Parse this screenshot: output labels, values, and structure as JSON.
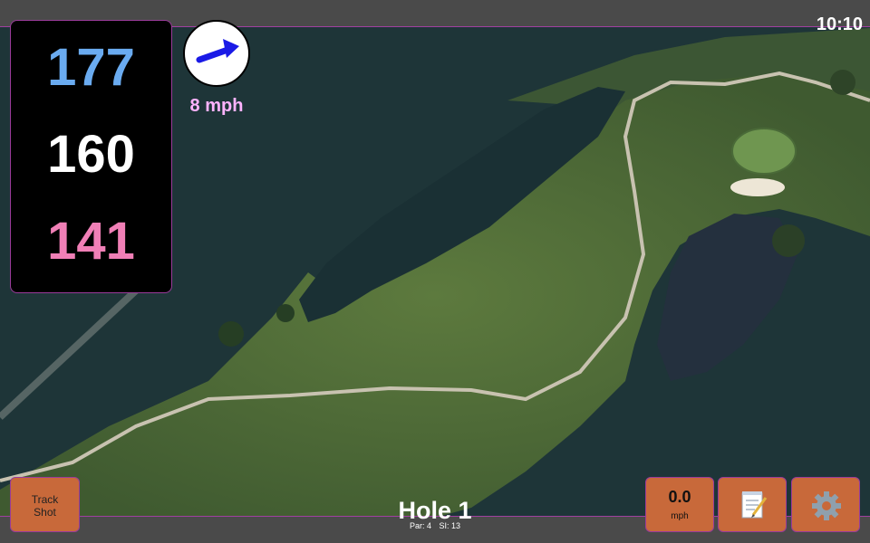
{
  "status": {
    "time": "10:10"
  },
  "distances": {
    "back": "177",
    "middle": "160",
    "front": "141"
  },
  "wind": {
    "speed": "8 mph",
    "arrow_color": "#1a1ae6"
  },
  "buttons": {
    "track_shot_line1": "Track",
    "track_shot_line2": "Shot",
    "speed_value": "0.0",
    "speed_unit": "mph",
    "notes_icon": "notepad-icon",
    "settings_icon": "gear-icon"
  },
  "hole": {
    "title": "Hole 1",
    "par": "Par: 4",
    "si": "SI: 13"
  },
  "colors": {
    "accent": "#9a3b9a",
    "button": "#c8693a",
    "back_distance": "#6aabf0",
    "front_distance": "#f07fb6"
  }
}
